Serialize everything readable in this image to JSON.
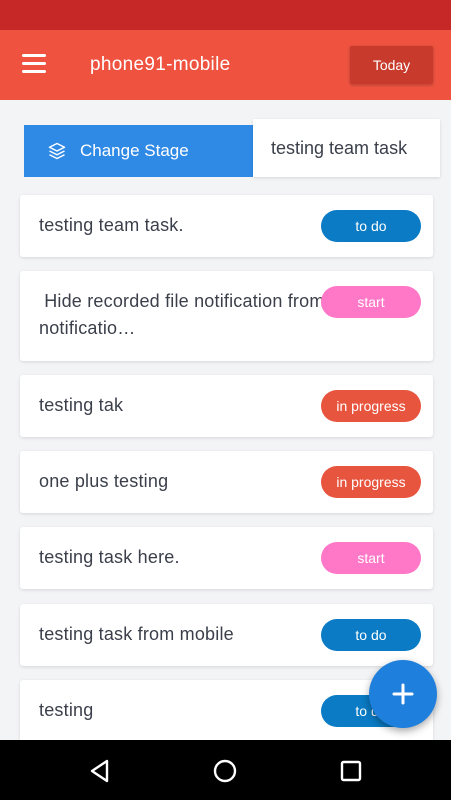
{
  "header": {
    "title": "phone91-mobile",
    "today_label": "Today",
    "menu_icon": "hamburger-menu-icon"
  },
  "stage": {
    "change_label": "Change Stage",
    "change_icon": "layers-icon",
    "active_tab": "testing team task"
  },
  "tasks": [
    {
      "title": "testing team task.",
      "status": "to do",
      "status_color": "#0a7bc4"
    },
    {
      "title": " Hide recorded file notification from notificatio…",
      "status": "start",
      "status_color": "#ff78c8"
    },
    {
      "title": "testing tak",
      "status": "in progress",
      "status_color": "#e8553f"
    },
    {
      "title": "one plus testing",
      "status": "in progress",
      "status_color": "#e8553f"
    },
    {
      "title": "testing task here.",
      "status": "start",
      "status_color": "#ff78c8"
    },
    {
      "title": "testing task from mobile",
      "status": "to do",
      "status_color": "#0a7bc4"
    },
    {
      "title": "testing",
      "status": "to do",
      "status_color": "#0a7bc4"
    }
  ],
  "fab": {
    "icon": "plus-icon"
  },
  "navigation": {
    "back_icon": "back-triangle-icon",
    "home_icon": "home-circle-icon",
    "recents_icon": "recents-square-icon"
  },
  "colors": {
    "app_bar": "#ef5340",
    "status_bar": "#c62828",
    "accent": "#2f8ae5"
  }
}
